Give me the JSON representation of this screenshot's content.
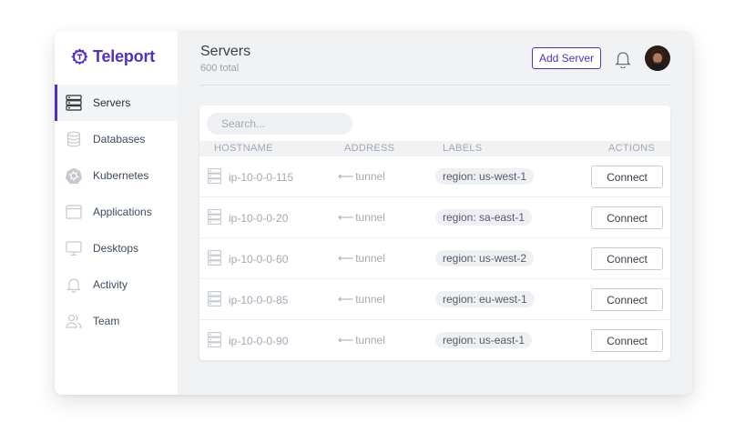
{
  "app": {
    "brand": "Teleport",
    "brand_color": "#512fc9"
  },
  "sidebar": {
    "items": [
      {
        "label": "Servers",
        "icon": "server-icon",
        "active": true
      },
      {
        "label": "Databases",
        "icon": "database-icon",
        "active": false
      },
      {
        "label": "Kubernetes",
        "icon": "kubernetes-icon",
        "active": false
      },
      {
        "label": "Applications",
        "icon": "application-window-icon",
        "active": false
      },
      {
        "label": "Desktops",
        "icon": "monitor-icon",
        "active": false
      },
      {
        "label": "Activity",
        "icon": "bell-icon",
        "active": false
      },
      {
        "label": "Team",
        "icon": "users-icon",
        "active": false
      }
    ]
  },
  "header": {
    "title": "Servers",
    "subtitle": "600 total",
    "add_button": "Add Server"
  },
  "search": {
    "placeholder": "Search..."
  },
  "table": {
    "columns": [
      "HOSTNAME",
      "ADDRESS",
      "LABELS",
      "ACTIONS"
    ],
    "rows": [
      {
        "hostname": "ip-10-0-0-115",
        "address": "tunnel",
        "label": "region: us-west-1",
        "action": "Connect"
      },
      {
        "hostname": "ip-10-0-0-20",
        "address": "tunnel",
        "label": "region: sa-east-1",
        "action": "Connect"
      },
      {
        "hostname": "ip-10-0-0-60",
        "address": "tunnel",
        "label": "region: us-west-2",
        "action": "Connect"
      },
      {
        "hostname": "ip-10-0-0-85",
        "address": "tunnel",
        "label": "region: eu-west-1",
        "action": "Connect"
      },
      {
        "hostname": "ip-10-0-0-90",
        "address": "tunnel",
        "label": "region: us-east-1",
        "action": "Connect"
      }
    ]
  }
}
